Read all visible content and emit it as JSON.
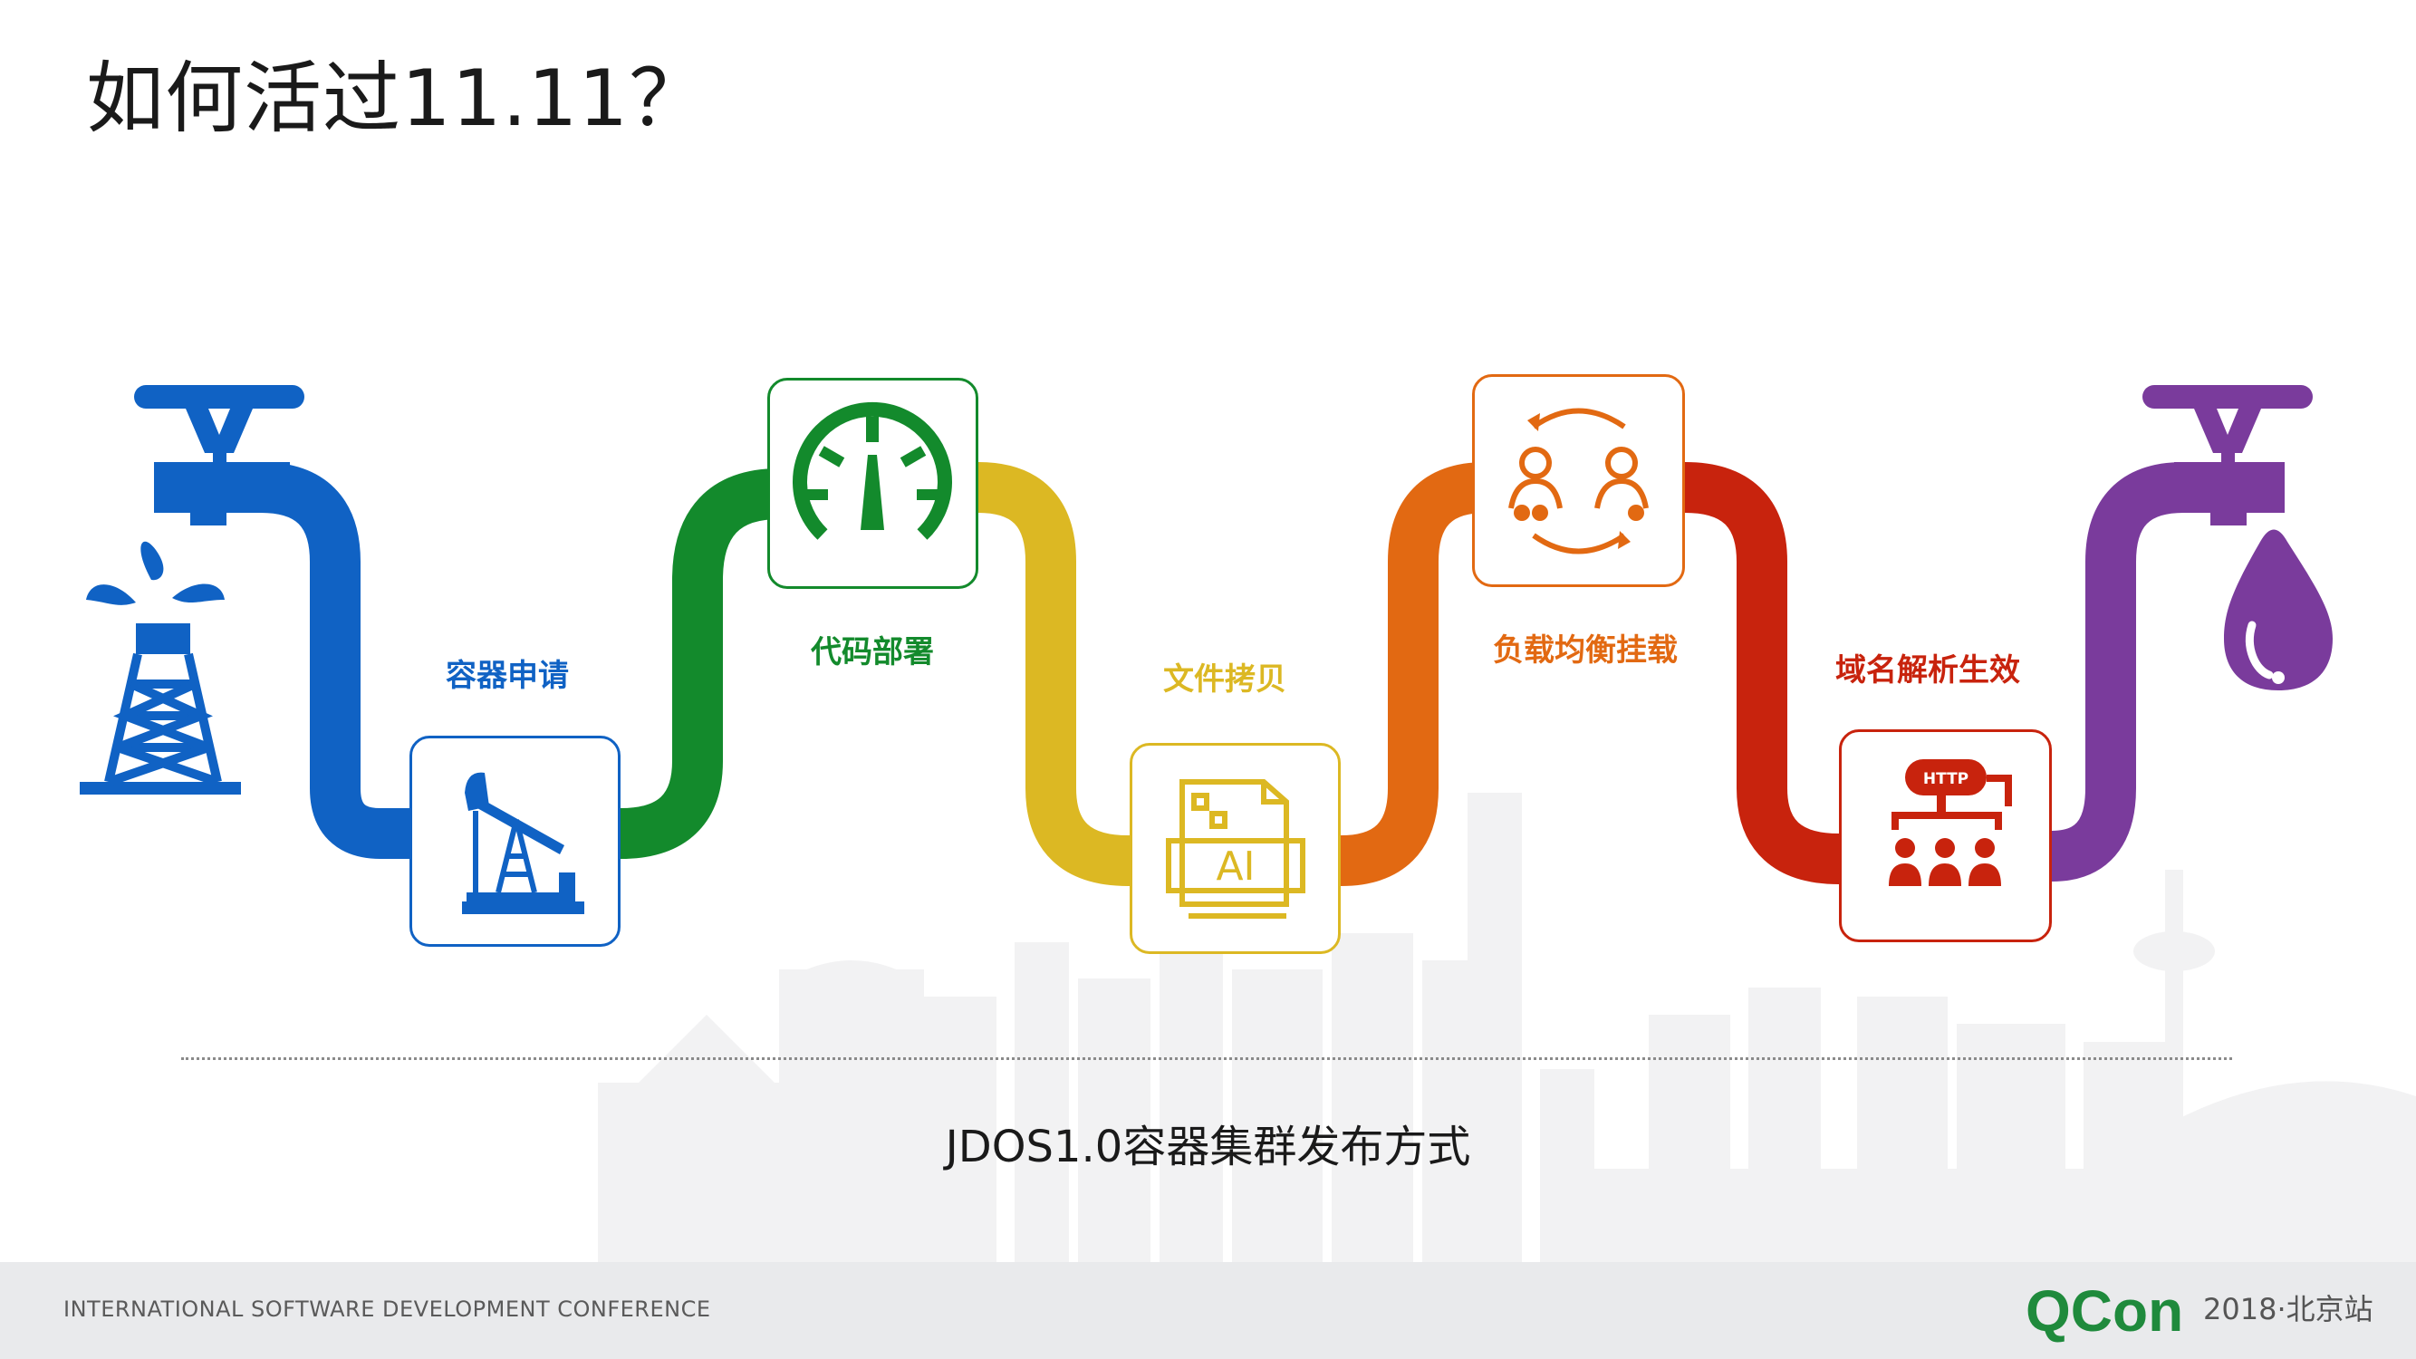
{
  "slide": {
    "title": "如何活过11.11？",
    "caption": "JDOS1.0容器集群发布方式"
  },
  "steps": [
    {
      "label": "容器申请",
      "color": "#1062c4",
      "icon": "oil-pump-icon"
    },
    {
      "label": "代码部署",
      "color": "#138a2c",
      "icon": "gauge-icon"
    },
    {
      "label": "文件拷贝",
      "color": "#dcb823",
      "icon": "ai-file-icon"
    },
    {
      "label": "负载均衡挂载",
      "color": "#e26912",
      "icon": "user-exchange-icon"
    },
    {
      "label": "域名解析生效",
      "color": "#c8230d",
      "icon": "http-network-icon"
    }
  ],
  "pipes": {
    "start_color": "#1062c4",
    "end_color": "#7a3b9c",
    "start_icon": "oil-derrick-icon",
    "end_icon": "water-drop-icon",
    "faucet_icon": "faucet-icon"
  },
  "footer": {
    "conference_name": "INTERNATIONAL SOFTWARE DEVELOPMENT CONFERENCE",
    "logo_text": "QCon",
    "edition": "2018·北京站"
  },
  "colors": {
    "footer_bg": "#e9eaec",
    "skyline": "#f1f1f2",
    "qcon_green": "#1f8a3c"
  }
}
